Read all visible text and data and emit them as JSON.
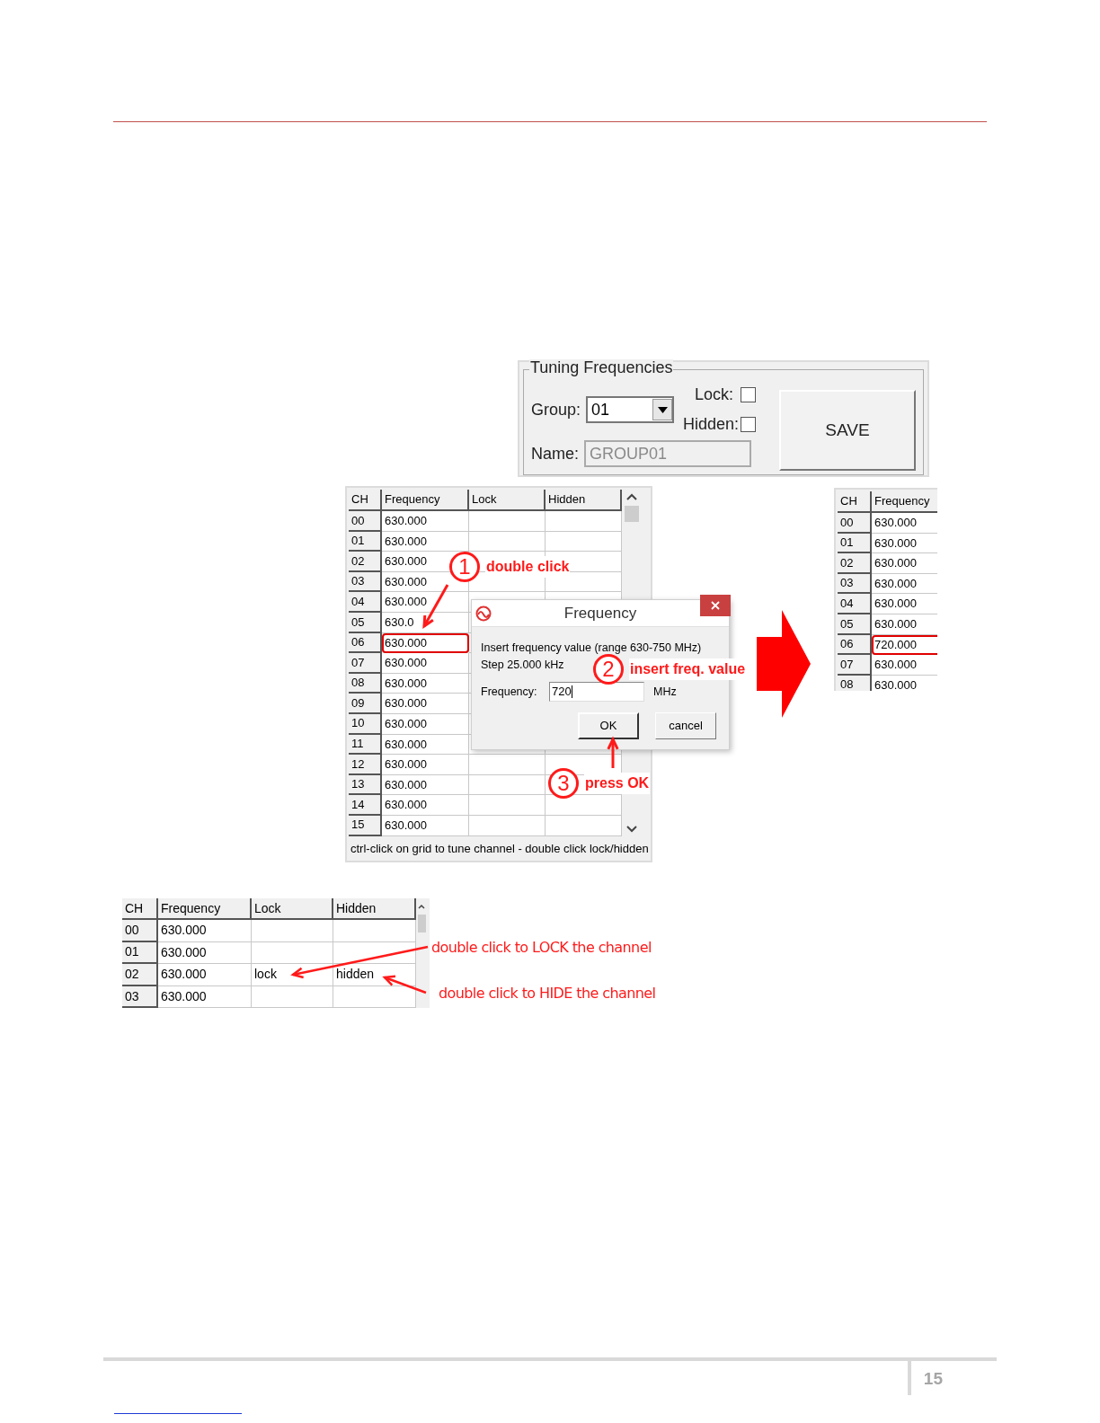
{
  "tuning_panel": {
    "title": "Tuning Frequencies",
    "group": {
      "label": "Group:",
      "value": "01"
    },
    "lock": {
      "label": "Lock:",
      "checked": false
    },
    "hidden": {
      "label": "Hidden:",
      "checked": false
    },
    "name": {
      "label": "Name:",
      "value": "GROUP01",
      "disabled": true
    },
    "save_button": "SAVE"
  },
  "channel_grid": {
    "columns": [
      "CH",
      "Frequency",
      "Lock",
      "Hidden"
    ],
    "rows": [
      {
        "ch": "00",
        "frequency": "630.000",
        "highlighted": false
      },
      {
        "ch": "01",
        "frequency": "630.000",
        "highlighted": false
      },
      {
        "ch": "02",
        "frequency": "630.000",
        "highlighted": false
      },
      {
        "ch": "03",
        "frequency": "630.000",
        "highlighted": false
      },
      {
        "ch": "04",
        "frequency": "630.000",
        "highlighted": false
      },
      {
        "ch": "05",
        "frequency": "630.0",
        "highlighted": false
      },
      {
        "ch": "06",
        "frequency": "630.000",
        "highlighted": true
      },
      {
        "ch": "07",
        "frequency": "630.000",
        "highlighted": false
      },
      {
        "ch": "08",
        "frequency": "630.000",
        "highlighted": false
      },
      {
        "ch": "09",
        "frequency": "630.000",
        "highlighted": false
      },
      {
        "ch": "10",
        "frequency": "630.000",
        "highlighted": false
      },
      {
        "ch": "11",
        "frequency": "630.000",
        "highlighted": false
      },
      {
        "ch": "12",
        "frequency": "630.000",
        "highlighted": false
      },
      {
        "ch": "13",
        "frequency": "630.000",
        "highlighted": false
      },
      {
        "ch": "14",
        "frequency": "630.000",
        "highlighted": false
      },
      {
        "ch": "15",
        "frequency": "630.000",
        "highlighted": false
      }
    ],
    "status": "ctrl-click on grid to tune channel - double click lock/hidden"
  },
  "dialog": {
    "title": "Frequency",
    "message": [
      "Insert frequency value (range 630-750 MHz)",
      "Step 25.000 kHz"
    ],
    "field": {
      "label": "Frequency:",
      "value": "720",
      "unit": "MHz"
    },
    "buttons": [
      {
        "label": "OK",
        "default": true
      },
      {
        "label": "cancel",
        "default": false
      }
    ]
  },
  "steps": [
    {
      "number": "1",
      "text": "double click"
    },
    {
      "number": "2",
      "text": "insert freq. value"
    },
    {
      "number": "3",
      "text": "press OK"
    }
  ],
  "result_grid": {
    "columns": [
      "CH",
      "Frequency"
    ],
    "rows": [
      {
        "ch": "00",
        "frequency": "630.000",
        "highlighted": false
      },
      {
        "ch": "01",
        "frequency": "630.000",
        "highlighted": false
      },
      {
        "ch": "02",
        "frequency": "630.000",
        "highlighted": false
      },
      {
        "ch": "03",
        "frequency": "630.000",
        "highlighted": false
      },
      {
        "ch": "04",
        "frequency": "630.000",
        "highlighted": false
      },
      {
        "ch": "05",
        "frequency": "630.000",
        "highlighted": false
      },
      {
        "ch": "06",
        "frequency": "720.000",
        "highlighted": true
      },
      {
        "ch": "07",
        "frequency": "630.000",
        "highlighted": false
      },
      {
        "ch": "08",
        "frequency": "630.000",
        "highlighted": false
      }
    ]
  },
  "lock_grid": {
    "columns": [
      "CH",
      "Frequency",
      "Lock",
      "Hidden"
    ],
    "rows": [
      {
        "ch": "00",
        "frequency": "630.000"
      },
      {
        "ch": "01",
        "frequency": "630.000"
      },
      {
        "ch": "02",
        "frequency": "630.000",
        "lock": "lock",
        "hidden": "hidden"
      },
      {
        "ch": "03",
        "frequency": "630.000"
      }
    ]
  },
  "notes": [
    "double click to LOCK the channel",
    "double click to HIDE the channel"
  ],
  "page_number": "15"
}
